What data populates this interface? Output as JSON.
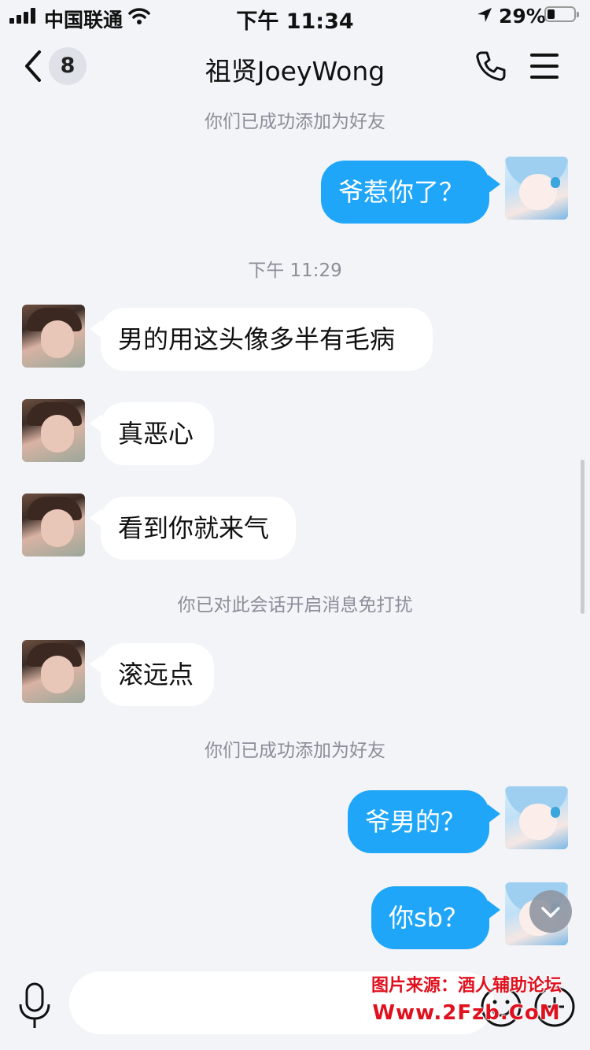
{
  "status_bar": {
    "carrier": "中国联通",
    "time": "下午 11:34",
    "battery_percent": "29%",
    "battery_level": 0.29
  },
  "nav": {
    "unread_count": "8",
    "title": "祖贤JoeyWong",
    "icons": [
      "chevron-left-icon",
      "phone-icon",
      "menu-icon"
    ]
  },
  "chat": {
    "system_1": "你们已成功添加为好友",
    "msg_1": "爷惹你了？",
    "timestamp_1": "下午 11:29",
    "msg_2": "男的用这头像多半有毛病",
    "msg_3": "真恶心",
    "msg_4": "看到你就来气",
    "system_2": "你已对此会话开启消息免打扰",
    "msg_5": "滚远点",
    "system_3": "你们已成功添加为好友",
    "msg_6": "爷男的？",
    "msg_7": "你sb？"
  },
  "input_bar": {
    "icons": [
      "microphone-icon",
      "emoji-icon",
      "plus-icon"
    ]
  },
  "watermark": {
    "line1": "图片来源：酒人辅助论坛",
    "line2": "Www.2Fzb.CoM"
  },
  "colors": {
    "my_bubble": "#1fa6f8",
    "their_bubble": "#ffffff",
    "background": "#f3f4f8",
    "watermark": "#e0101e"
  }
}
